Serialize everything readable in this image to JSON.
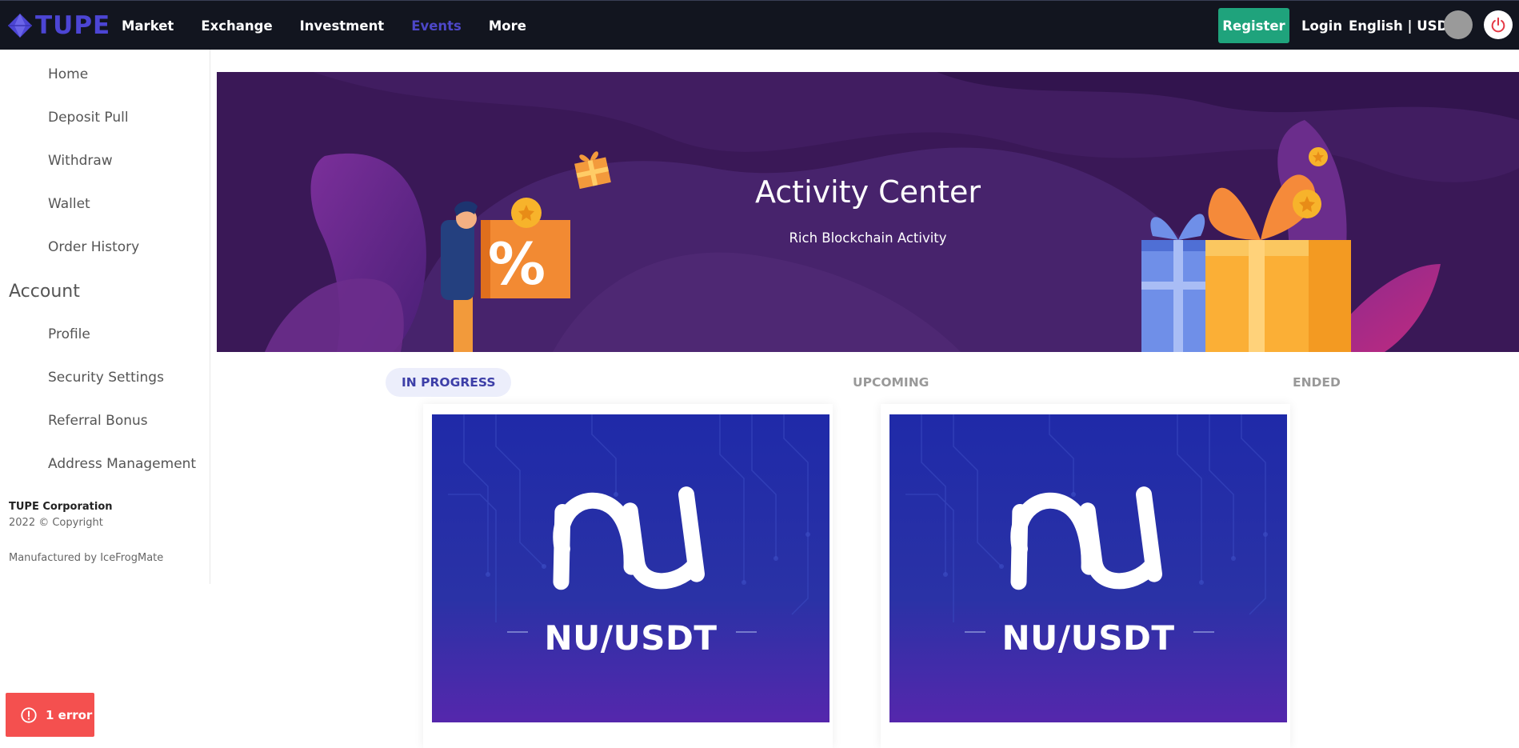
{
  "brand": {
    "logo_text": "TUPE",
    "accent": "#4c45d4"
  },
  "nav": {
    "items": [
      {
        "label": "Market"
      },
      {
        "label": "Exchange"
      },
      {
        "label": "Investment"
      },
      {
        "label": "Events",
        "active": true
      },
      {
        "label": "More"
      }
    ],
    "register_label": "Register",
    "login_label": "Login",
    "lang_label": "English | USD",
    "icons": [
      "avatar",
      "power-icon"
    ]
  },
  "sidebar": {
    "items": [
      {
        "label": "Home"
      },
      {
        "label": "Deposit Pull"
      },
      {
        "label": "Withdraw"
      },
      {
        "label": "Wallet"
      },
      {
        "label": "Order History"
      }
    ],
    "account_heading": "Account",
    "account_items": [
      {
        "label": "Profile"
      },
      {
        "label": "Security Settings"
      },
      {
        "label": "Referral Bonus"
      },
      {
        "label": "Address Management"
      }
    ],
    "footer": {
      "corp": "TUPE Corporation",
      "copyright": "2022 © Copyright",
      "manufactured": "Manufactured by IceFrogMate"
    }
  },
  "banner": {
    "title": "Activity Center",
    "subtitle": "Rich Blockchain Activity",
    "percent_glyph": "%"
  },
  "tabs": [
    {
      "label": "IN PROGRESS",
      "active": true
    },
    {
      "label": "UPCOMING"
    },
    {
      "label": "ENDED"
    }
  ],
  "cards": [
    {
      "pair": "NU/USDT",
      "logo_text": "nu"
    },
    {
      "pair": "NU/USDT",
      "logo_text": "nu"
    }
  ],
  "toast": {
    "label": "1 error",
    "color": "#f4504f"
  },
  "colors": {
    "register": "#1fa37c",
    "nav_bg": "#12151f",
    "banner_bg": "#3a1857",
    "card_bg": "#2a32a6"
  }
}
